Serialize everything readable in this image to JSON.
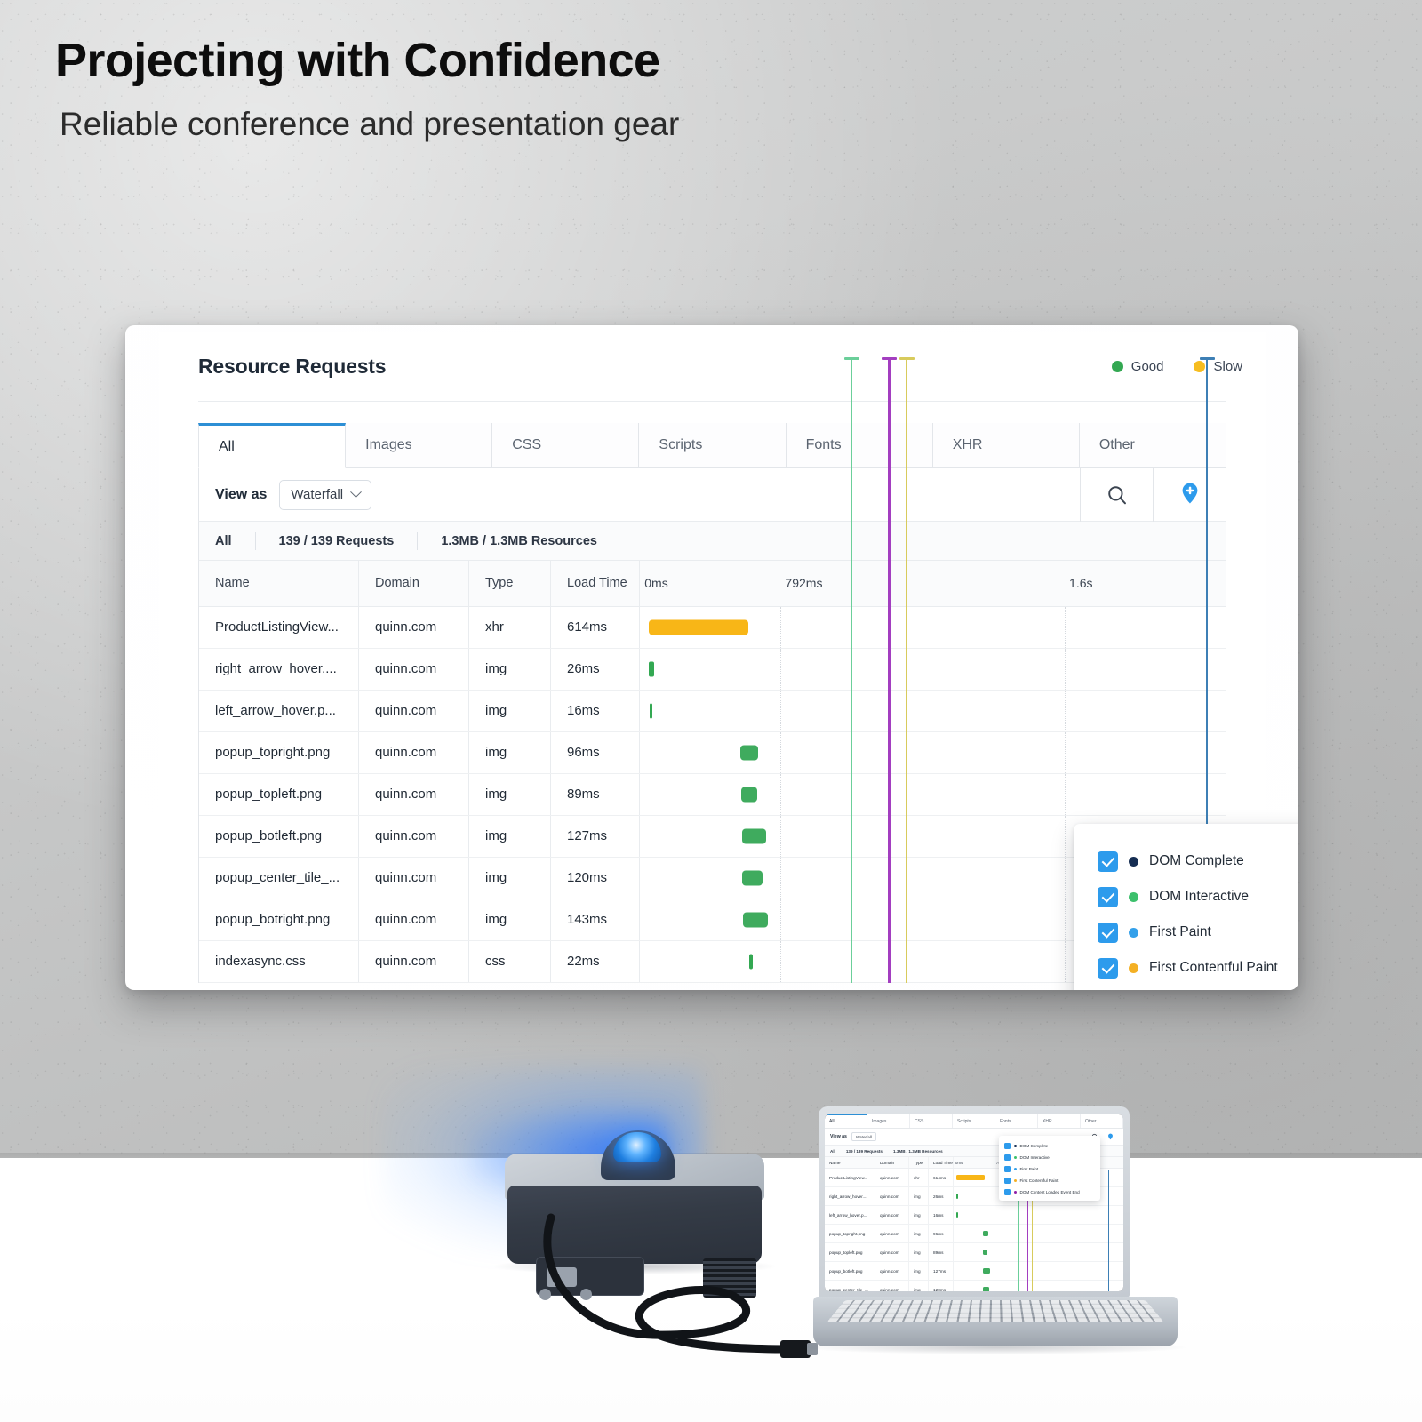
{
  "hero": {
    "headline": "Projecting with Confidence",
    "subhead": "Reliable conference and presentation gear"
  },
  "app": {
    "title": "Resource Requests",
    "legend": [
      {
        "label": "Good",
        "color": "#33a852"
      },
      {
        "label": "Slow",
        "color": "#f6bd20"
      }
    ],
    "tabs": [
      {
        "label": "All",
        "active": true
      },
      {
        "label": "Images",
        "active": false
      },
      {
        "label": "CSS",
        "active": false
      },
      {
        "label": "Scripts",
        "active": false
      },
      {
        "label": "Fonts",
        "active": false
      },
      {
        "label": "XHR",
        "active": false
      },
      {
        "label": "Other",
        "active": false
      }
    ],
    "toolbar": {
      "view_as_label": "View as",
      "view_as_value": "Waterfall",
      "search_icon": "search-icon",
      "pin_icon": "map-pin-plus-icon"
    },
    "summary": {
      "scope": "All",
      "requests": "139 / 139 Requests",
      "resources": "1.3MB / 1.3MB Resources"
    },
    "table": {
      "columns": [
        "Name",
        "Domain",
        "Type",
        "Load Time"
      ],
      "timeline_ticks": [
        "0ms",
        "792ms",
        "1.6s"
      ],
      "rows": [
        {
          "name": "ProductListingView...",
          "domain": "quinn.com",
          "type": "xhr",
          "load": "614ms",
          "bar_start_pct": 1.5,
          "bar_width_pct": 17.0,
          "color": "#f8b617"
        },
        {
          "name": "right_arrow_hover....",
          "domain": "quinn.com",
          "type": "img",
          "load": "26ms",
          "bar_start_pct": 1.5,
          "bar_width_pct": 0.9,
          "color": "#33a852"
        },
        {
          "name": "left_arrow_hover.p...",
          "domain": "quinn.com",
          "type": "img",
          "load": "16ms",
          "bar_start_pct": 1.6,
          "bar_width_pct": 0.5,
          "color": "#33a852"
        },
        {
          "name": "popup_topright.png",
          "domain": "quinn.com",
          "type": "img",
          "load": "96ms",
          "bar_start_pct": 17.2,
          "bar_width_pct": 3.0,
          "color": "#3fab5e"
        },
        {
          "name": "popup_topleft.png",
          "domain": "quinn.com",
          "type": "img",
          "load": "89ms",
          "bar_start_pct": 17.3,
          "bar_width_pct": 2.7,
          "color": "#3fab5e"
        },
        {
          "name": "popup_botleft.png",
          "domain": "quinn.com",
          "type": "img",
          "load": "127ms",
          "bar_start_pct": 17.5,
          "bar_width_pct": 4.0,
          "color": "#3fab5e"
        },
        {
          "name": "popup_center_tile_...",
          "domain": "quinn.com",
          "type": "img",
          "load": "120ms",
          "bar_start_pct": 17.4,
          "bar_width_pct": 3.6,
          "color": "#3fab5e"
        },
        {
          "name": "popup_botright.png",
          "domain": "quinn.com",
          "type": "img",
          "load": "143ms",
          "bar_start_pct": 17.6,
          "bar_width_pct": 4.3,
          "color": "#3fab5e"
        },
        {
          "name": "indexasync.css",
          "domain": "quinn.com",
          "type": "css",
          "load": "22ms",
          "bar_start_pct": 18.6,
          "bar_width_pct": 0.7,
          "color": "#33a852"
        }
      ],
      "grid_pcts": [
        0.0,
        24.0,
        72.5
      ],
      "markers": [
        {
          "name": "DOM Interactive",
          "pct": 37.6,
          "color": "#6bcf9a"
        },
        {
          "name": "DOM Content Loaded Event End",
          "pct": 43.3,
          "color": "#a33ec0"
        },
        {
          "name": "First Contentful Paint",
          "pct": 45.9,
          "color": "#d8cb5c"
        },
        {
          "name": "DOM Complete",
          "pct": 91.0,
          "color": "#3d7fb5"
        }
      ]
    },
    "dropdown": {
      "items": [
        {
          "label": "DOM Complete",
          "color": "#152d52",
          "checked": true
        },
        {
          "label": "DOM Interactive",
          "color": "#3cc06c",
          "checked": true
        },
        {
          "label": "First Paint",
          "color": "#33a0ea",
          "checked": true
        },
        {
          "label": "First Contentful Paint",
          "color": "#f4b024",
          "checked": true
        },
        {
          "label": "DOM Content Loaded Event End",
          "color": "#8f1fa8",
          "checked": true
        }
      ]
    }
  },
  "scene": {
    "projector_label": "projector-device",
    "laptop_label": "laptop-device",
    "cable_label": "hdmi-cable"
  }
}
